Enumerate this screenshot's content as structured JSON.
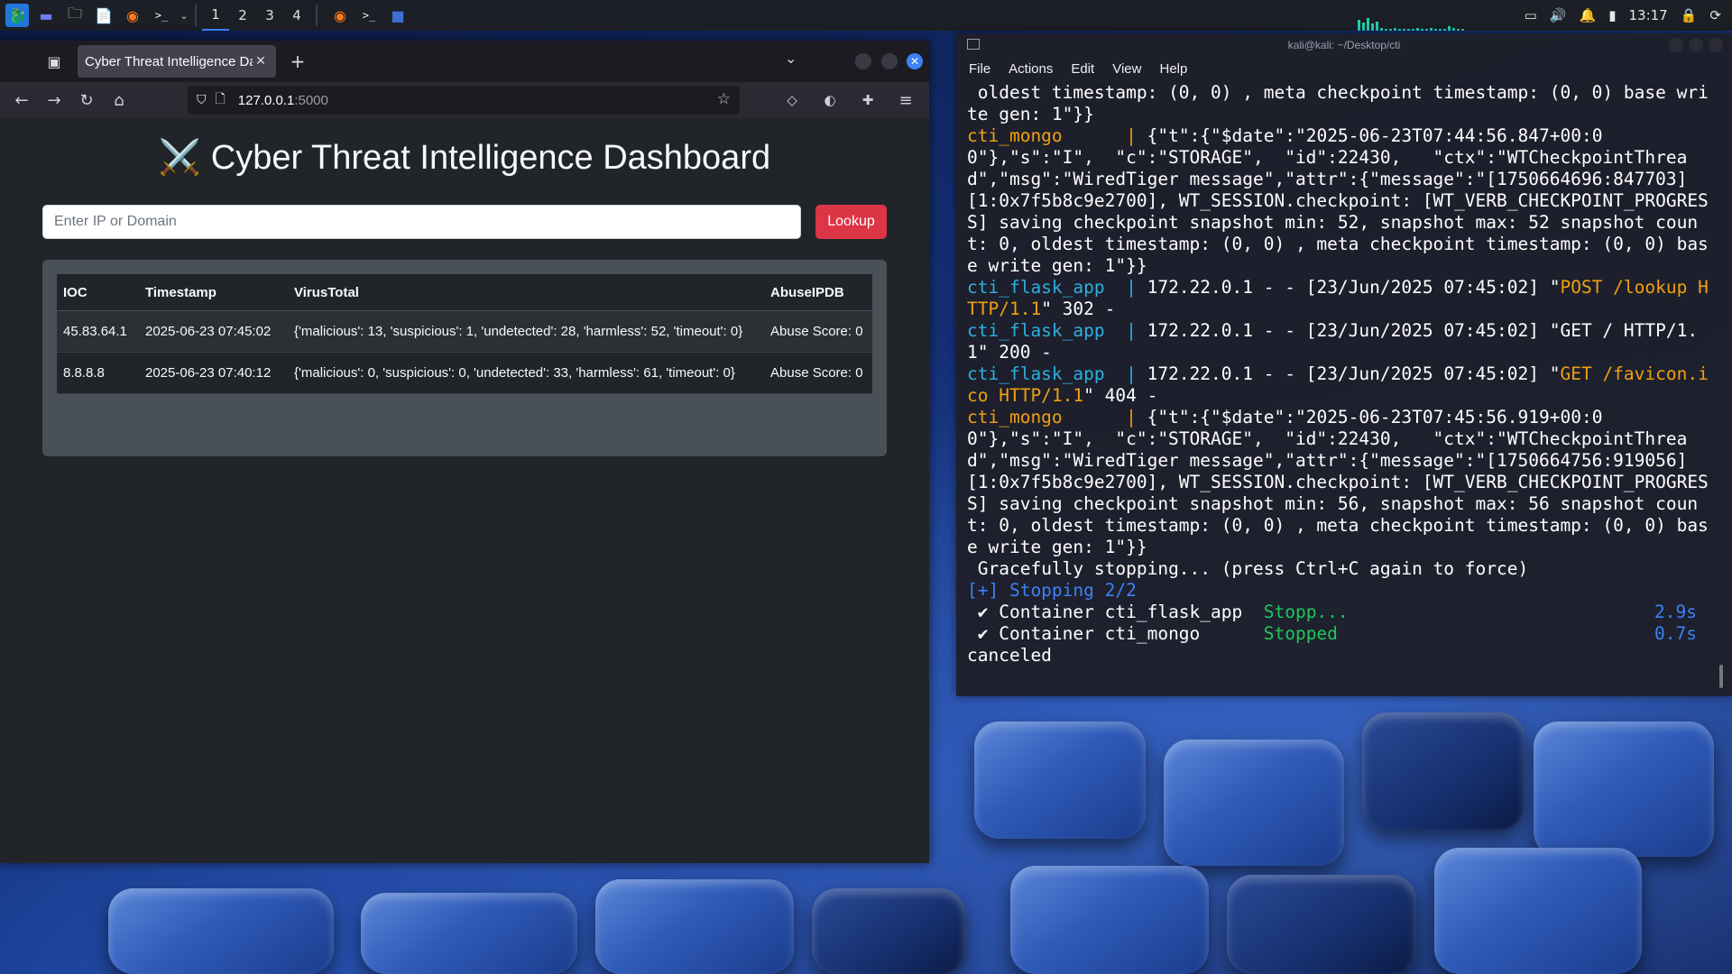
{
  "taskbar": {
    "workspaces": [
      "1",
      "2",
      "3",
      "4"
    ],
    "clock": "13:17"
  },
  "browser": {
    "tab_title": "Cyber Threat Intelligence Da",
    "url_host": "127.0.0.1",
    "url_port": ":5000"
  },
  "dashboard": {
    "icon": "⚔️",
    "title": "Cyber Threat Intelligence Dashboard",
    "input_placeholder": "Enter IP or Domain",
    "lookup_label": "Lookup",
    "columns": [
      "IOC",
      "Timestamp",
      "VirusTotal",
      "AbuseIPDB"
    ],
    "rows": [
      {
        "ioc": "45.83.64.1",
        "timestamp": "2025-06-23 07:45:02",
        "virustotal": "{'malicious': 13, 'suspicious': 1, 'undetected': 28, 'harmless': 52, 'timeout': 0}",
        "abuseipdb": "Abuse Score: 0"
      },
      {
        "ioc": "8.8.8.8",
        "timestamp": "2025-06-23 07:40:12",
        "virustotal": "{'malicious': 0, 'suspicious': 0, 'undetected': 33, 'harmless': 61, 'timeout': 0}",
        "abuseipdb": "Abuse Score: 0"
      }
    ]
  },
  "terminal": {
    "title": "kali@kali: ~/Desktop/cti",
    "menu": [
      "File",
      "Actions",
      "Edit",
      "View",
      "Help"
    ],
    "l1": " oldest timestamp: (0, 0) , meta checkpoint timestamp: (0, 0) base write gen: 1\"}}",
    "mongo_prefix": "cti_mongo     ",
    "flask_prefix": "cti_flask_app ",
    "pipe": " | ",
    "m1": "{\"t\":{\"$date\":\"2025-06-23T07:44:56.847+00:00\"},\"s\":\"I\",  \"c\":\"STORAGE\",  \"id\":22430,   \"ctx\":\"WTCheckpointThread\",\"msg\":\"WiredTiger message\",\"attr\":{\"message\":\"[1750664696:847703][1:0x7f5b8c9e2700], WT_SESSION.checkpoint: [WT_VERB_CHECKPOINT_PROGRESS] saving checkpoint snapshot min: 52, snapshot max: 52 snapshot count: 0, oldest timestamp: (0, 0) , meta checkpoint timestamp: (0, 0) base write gen: 1\"}}",
    "f1_pre": "172.22.0.1 - - [23/Jun/2025 07:45:02] \"",
    "f1_req": "POST /lookup HTTP/1.1",
    "f1_post": "\" 302 -",
    "f2": "172.22.0.1 - - [23/Jun/2025 07:45:02] \"GET / HTTP/1.1\" 200 -",
    "f3_pre": "172.22.0.1 - - [23/Jun/2025 07:45:02] \"",
    "f3_req": "GET /favicon.ico HTTP/1.1",
    "f3_post": "\" 404 -",
    "m2": "{\"t\":{\"$date\":\"2025-06-23T07:45:56.919+00:00\"},\"s\":\"I\",  \"c\":\"STORAGE\",  \"id\":22430,   \"ctx\":\"WTCheckpointThread\",\"msg\":\"WiredTiger message\",\"attr\":{\"message\":\"[1750664756:919056][1:0x7f5b8c9e2700], WT_SESSION.checkpoint: [WT_VERB_CHECKPOINT_PROGRESS] saving checkpoint snapshot min: 56, snapshot max: 56 snapshot count: 0, oldest timestamp: (0, 0) , meta checkpoint timestamp: (0, 0) base write gen: 1\"}}",
    "stopping_msg": " Gracefully stopping... (press Ctrl+C again to force)",
    "stopping_status": "[+] Stopping 2/2",
    "c1_name": " ✔ Container cti_flask_app  ",
    "c1_state": "Stopp...",
    "c1_time": "2.9s",
    "c2_name": " ✔ Container cti_mongo      ",
    "c2_state": "Stopped",
    "c2_time": "0.7s",
    "last": "canceled"
  },
  "colors": {
    "lookup_button": "#dc3545",
    "mongo_prefix": "#f0a010",
    "flask_prefix": "#2bb0e0",
    "terminal_bg": "#1e1f29"
  }
}
